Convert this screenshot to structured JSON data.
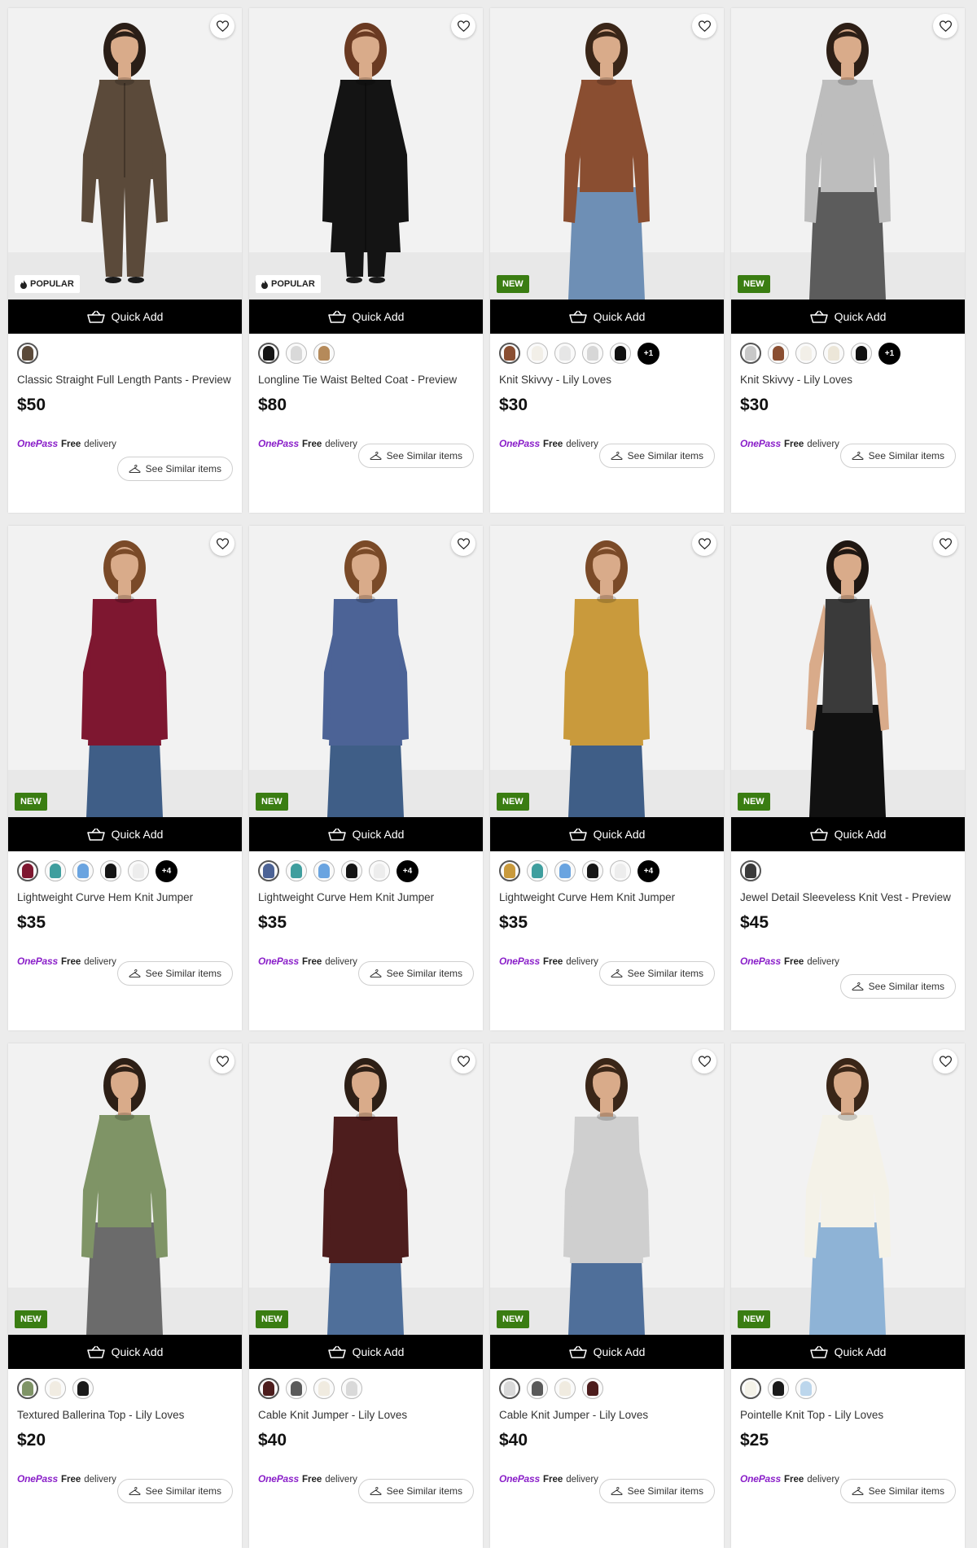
{
  "quick_add_label": "Quick Add",
  "similar_label": "See Similar items",
  "onepass_label": "OnePass",
  "free_label": "Free",
  "delivery_label": "delivery",
  "products": [
    {
      "name": "Classic Straight Full Length Pants - Preview",
      "price": "$50",
      "badge": "POPULAR",
      "badge_type": "popular",
      "more": "",
      "garment": "#5b4a3a",
      "lower": "#5b4a3a",
      "hair": "#2a1e17",
      "style": "suit",
      "swatches": [
        "#5b4a3a"
      ]
    },
    {
      "name": "Longline Tie Waist Belted Coat - Preview",
      "price": "$80",
      "badge": "POPULAR",
      "badge_type": "popular",
      "more": "",
      "garment": "#141414",
      "lower": "#141414",
      "hair": "#6a3a22",
      "style": "coat",
      "swatches": [
        "#141414",
        "#d9d9d9",
        "#b58a5a"
      ]
    },
    {
      "name": "Knit Skivvy - Lily Loves",
      "price": "$30",
      "badge": "NEW",
      "badge_type": "new",
      "more": "+1",
      "garment": "#8a4e31",
      "lower": "#6e8fb5",
      "hair": "#3a2618",
      "style": "top",
      "swatches": [
        "#8a4e31",
        "#f2efe8",
        "#e6e6e6",
        "#d7d7d7",
        "#111111"
      ]
    },
    {
      "name": "Knit Skivvy - Lily Loves",
      "price": "$30",
      "badge": "NEW",
      "badge_type": "new",
      "more": "+1",
      "garment": "#bdbdbd",
      "lower": "#5c5c5c",
      "hair": "#2d1f16",
      "style": "top",
      "swatches": [
        "#c8c8c8",
        "#8a4e31",
        "#f2efe8",
        "#ece6d8",
        "#111111"
      ]
    },
    {
      "name": "Lightweight Curve Hem Knit Jumper",
      "price": "$35",
      "badge": "NEW",
      "badge_type": "new",
      "more": "+4",
      "garment": "#7e1730",
      "lower": "#3f5e87",
      "hair": "#7a4a28",
      "style": "jumper",
      "swatches": [
        "#7e1730",
        "#3f9e9e",
        "#6aa4e0",
        "#151515",
        "#ededed"
      ]
    },
    {
      "name": "Lightweight Curve Hem Knit Jumper",
      "price": "$35",
      "badge": "NEW",
      "badge_type": "new",
      "more": "+4",
      "garment": "#4c6396",
      "lower": "#3f5e87",
      "hair": "#7a4a28",
      "style": "jumper",
      "swatches": [
        "#4c6396",
        "#3f9e9e",
        "#6aa4e0",
        "#151515",
        "#ededed"
      ]
    },
    {
      "name": "Lightweight Curve Hem Knit Jumper",
      "price": "$35",
      "badge": "NEW",
      "badge_type": "new",
      "more": "+4",
      "garment": "#c99a3c",
      "lower": "#3f5e87",
      "hair": "#7a4a28",
      "style": "jumper",
      "swatches": [
        "#c99a3c",
        "#3f9e9e",
        "#6aa4e0",
        "#151515",
        "#ededed"
      ]
    },
    {
      "name": "Jewel Detail Sleeveless Knit Vest - Preview",
      "price": "$45",
      "badge": "NEW",
      "badge_type": "new",
      "more": "",
      "garment": "#3a3a3a",
      "lower": "#111111",
      "hair": "#1f1712",
      "style": "vest",
      "swatches": [
        "#3a3a3a"
      ]
    },
    {
      "name": "Textured Ballerina Top - Lily Loves",
      "price": "$20",
      "badge": "NEW",
      "badge_type": "new",
      "more": "",
      "garment": "#7f9466",
      "lower": "#6b6b6b",
      "hair": "#2d1f16",
      "style": "top",
      "swatches": [
        "#7f9466",
        "#f1ece2",
        "#1a1a1a"
      ]
    },
    {
      "name": "Cable Knit Jumper - Lily Loves",
      "price": "$40",
      "badge": "NEW",
      "badge_type": "new",
      "more": "",
      "garment": "#4d1d1d",
      "lower": "#4f6f9a",
      "hair": "#2d1f16",
      "style": "jumper",
      "swatches": [
        "#4d1d1d",
        "#5a5a5a",
        "#f0ebe0",
        "#d9d9d9"
      ]
    },
    {
      "name": "Cable Knit Jumper - Lily Loves",
      "price": "$40",
      "badge": "NEW",
      "badge_type": "new",
      "more": "",
      "garment": "#cfcfcf",
      "lower": "#4f6f9a",
      "hair": "#3a2618",
      "style": "jumper",
      "swatches": [
        "#d9d9d9",
        "#5a5a5a",
        "#f0ebe0",
        "#4d1d1d"
      ]
    },
    {
      "name": "Pointelle Knit Top - Lily Loves",
      "price": "$25",
      "badge": "NEW",
      "badge_type": "new",
      "more": "",
      "garment": "#f4f2e8",
      "lower": "#8eb3d6",
      "hair": "#3a2618",
      "style": "top",
      "swatches": [
        "#f4f2e8",
        "#1a1a1a",
        "#bcd6ec"
      ]
    }
  ]
}
